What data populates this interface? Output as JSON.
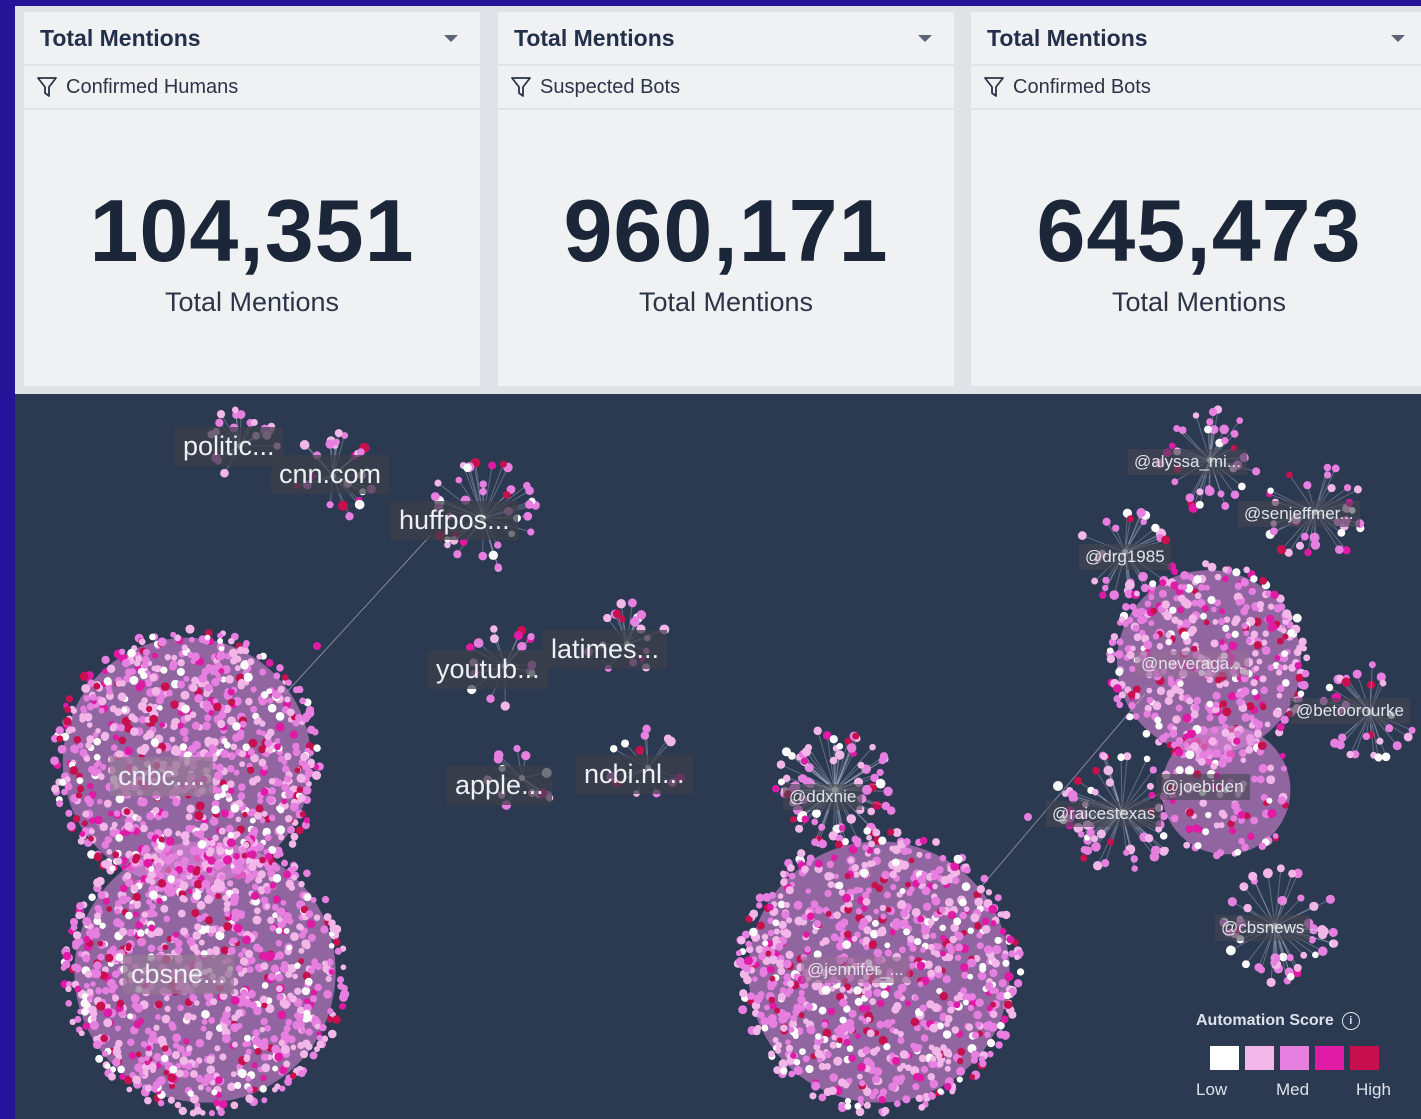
{
  "cards": [
    {
      "title": "Total Mentions",
      "filter": "Confirmed Humans",
      "value": "104,351",
      "label": "Total Mentions"
    },
    {
      "title": "Total Mentions",
      "filter": "Suspected Bots",
      "value": "960,171",
      "label": "Total Mentions"
    },
    {
      "title": "Total Mentions",
      "filter": "Confirmed Bots",
      "value": "645,473",
      "label": "Total Mentions"
    }
  ],
  "clusters": [
    {
      "label": "politic...",
      "size": "large"
    },
    {
      "label": "cnn.com",
      "size": "large"
    },
    {
      "label": "huffpos...",
      "size": "large"
    },
    {
      "label": "latimes...",
      "size": "large"
    },
    {
      "label": "youtub...",
      "size": "large"
    },
    {
      "label": "apple...",
      "size": "large"
    },
    {
      "label": "ncbi.nl...",
      "size": "large"
    },
    {
      "label": "cnbc....",
      "size": "large"
    },
    {
      "label": "cbsne...",
      "size": "large"
    },
    {
      "label": "@alyssa_mi...",
      "size": "small"
    },
    {
      "label": "@senjeffmer...",
      "size": "small"
    },
    {
      "label": "@drg1985",
      "size": "small"
    },
    {
      "label": "@neveraga...",
      "size": "small"
    },
    {
      "label": "@betoorourke",
      "size": "small"
    },
    {
      "label": "@joebiden",
      "size": "small"
    },
    {
      "label": "@raicestexas",
      "size": "small"
    },
    {
      "label": "@ddxnie",
      "size": "small"
    },
    {
      "label": "@cbsnews",
      "size": "small"
    },
    {
      "label": "@jennifer_...",
      "size": "small"
    }
  ],
  "legend": {
    "title": "Automation Score",
    "info_icon": "info-icon",
    "colors": [
      "#ffffff",
      "#f2b6e9",
      "#e77fe0",
      "#e01aa5",
      "#c8104f"
    ],
    "low": "Low",
    "med": "Med",
    "high": "High"
  },
  "icons": {
    "filter": "filter-icon",
    "dropdown": "dropdown-caret-icon"
  }
}
